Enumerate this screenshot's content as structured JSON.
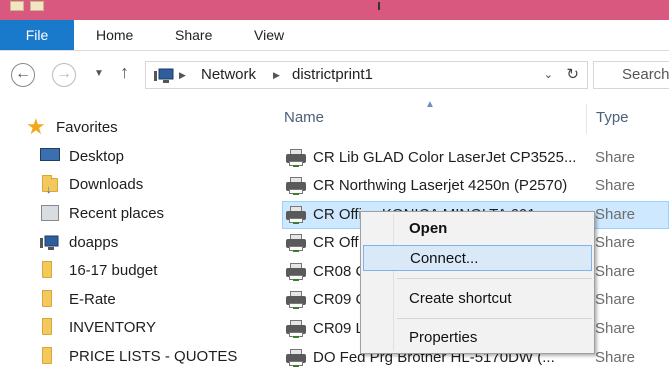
{
  "ribbon": {
    "tabs": [
      "File",
      "Home",
      "Share",
      "View"
    ],
    "file_color": "#1979ca",
    "title_bar_color": "#d9587f"
  },
  "address_bar": {
    "breadcrumbs": [
      "Network",
      "districtprint1"
    ],
    "search_placeholder": "Search"
  },
  "nav_pane": {
    "items": [
      {
        "label": "Favorites",
        "icon": "star-icon"
      },
      {
        "label": "Desktop",
        "icon": "desktop-icon"
      },
      {
        "label": "Downloads",
        "icon": "downloads-folder-icon"
      },
      {
        "label": "Recent places",
        "icon": "recent-places-icon"
      },
      {
        "label": "doapps",
        "icon": "network-computer-icon"
      },
      {
        "label": "16-17 budget",
        "icon": "folder-icon"
      },
      {
        "label": "E-Rate",
        "icon": "folder-icon"
      },
      {
        "label": "INVENTORY",
        "icon": "folder-icon"
      },
      {
        "label": "PRICE LISTS - QUOTES",
        "icon": "folder-icon"
      }
    ]
  },
  "file_list": {
    "columns": [
      "Name",
      "Type"
    ],
    "rows": [
      {
        "name": "CR Lib GLAD Color LaserJet CP3525...",
        "type": "Share"
      },
      {
        "name": "CR Northwing Laserjet 4250n (P2570)",
        "type": "Share"
      },
      {
        "name": "CR Office KONICA MINOLTA 601...",
        "type": "Share",
        "selected": true
      },
      {
        "name": "CR Off",
        "type": "Share"
      },
      {
        "name": "CR08 C",
        "type": "Share"
      },
      {
        "name": "CR09 C",
        "type": "Share"
      },
      {
        "name": "CR09 L",
        "type": "Share"
      },
      {
        "name": "DO Fed Prg Brother HL-5170DW (...",
        "type": "Share"
      }
    ]
  },
  "context_menu": {
    "items": [
      {
        "label": "Open",
        "bold": true
      },
      {
        "label": "Connect...",
        "highlighted": true
      },
      {
        "label": "Create shortcut"
      },
      {
        "label": "Properties"
      }
    ]
  }
}
